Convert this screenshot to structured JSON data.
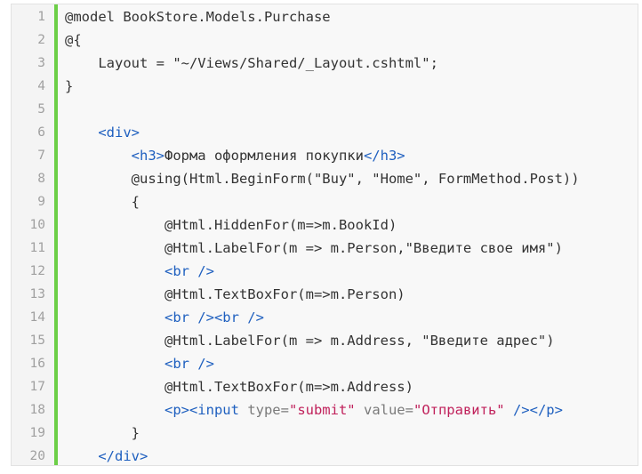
{
  "colors": {
    "background": "#f8f8f8",
    "gutter_bar": "#6ccf47",
    "line_number": "#a0a0a0",
    "plain": "#333333",
    "tag": "#1e5fbf",
    "attr": "#7a7a7a",
    "string": "#c0215b"
  },
  "lines": [
    {
      "n": "1",
      "tokens": [
        {
          "t": "@model BookStore.Models.Purchase",
          "c": "plain"
        }
      ]
    },
    {
      "n": "2",
      "tokens": [
        {
          "t": "@{",
          "c": "plain"
        }
      ]
    },
    {
      "n": "3",
      "tokens": [
        {
          "t": "    Layout = \"~/Views/Shared/_Layout.cshtml\";",
          "c": "plain"
        }
      ]
    },
    {
      "n": "4",
      "tokens": [
        {
          "t": "}",
          "c": "plain"
        }
      ]
    },
    {
      "n": "5",
      "tokens": []
    },
    {
      "n": "6",
      "tokens": [
        {
          "t": "    ",
          "c": "plain"
        },
        {
          "t": "<div>",
          "c": "tag"
        }
      ]
    },
    {
      "n": "7",
      "tokens": [
        {
          "t": "        ",
          "c": "plain"
        },
        {
          "t": "<h3>",
          "c": "tag"
        },
        {
          "t": "Форма оформления покупки",
          "c": "plain"
        },
        {
          "t": "</h3>",
          "c": "tag"
        }
      ]
    },
    {
      "n": "8",
      "tokens": [
        {
          "t": "        @using(Html.BeginForm(\"Buy\", \"Home\", FormMethod.Post))",
          "c": "plain"
        }
      ]
    },
    {
      "n": "9",
      "tokens": [
        {
          "t": "        {",
          "c": "plain"
        }
      ]
    },
    {
      "n": "10",
      "tokens": [
        {
          "t": "            @Html.HiddenFor(m=>m.BookId)",
          "c": "plain"
        }
      ]
    },
    {
      "n": "11",
      "tokens": [
        {
          "t": "            @Html.LabelFor(m => m.Person,\"Введите свое имя\")",
          "c": "plain"
        }
      ]
    },
    {
      "n": "12",
      "tokens": [
        {
          "t": "            ",
          "c": "plain"
        },
        {
          "t": "<br />",
          "c": "tag"
        }
      ]
    },
    {
      "n": "13",
      "tokens": [
        {
          "t": "            @Html.TextBoxFor(m=>m.Person)",
          "c": "plain"
        }
      ]
    },
    {
      "n": "14",
      "tokens": [
        {
          "t": "            ",
          "c": "plain"
        },
        {
          "t": "<br /><br />",
          "c": "tag"
        }
      ]
    },
    {
      "n": "15",
      "tokens": [
        {
          "t": "            @Html.LabelFor(m => m.Address, \"Введите адрес\")",
          "c": "plain"
        }
      ]
    },
    {
      "n": "16",
      "tokens": [
        {
          "t": "            ",
          "c": "plain"
        },
        {
          "t": "<br />",
          "c": "tag"
        }
      ]
    },
    {
      "n": "17",
      "tokens": [
        {
          "t": "            @Html.TextBoxFor(m=>m.Address)",
          "c": "plain"
        }
      ]
    },
    {
      "n": "18",
      "tokens": [
        {
          "t": "            ",
          "c": "plain"
        },
        {
          "t": "<p><input ",
          "c": "tag"
        },
        {
          "t": "type=",
          "c": "attr"
        },
        {
          "t": "\"submit\"",
          "c": "str"
        },
        {
          "t": " ",
          "c": "plain"
        },
        {
          "t": "value=",
          "c": "attr"
        },
        {
          "t": "\"Отправить\"",
          "c": "str"
        },
        {
          "t": " /></p>",
          "c": "tag"
        }
      ]
    },
    {
      "n": "19",
      "tokens": [
        {
          "t": "        }",
          "c": "plain"
        }
      ]
    },
    {
      "n": "20",
      "tokens": [
        {
          "t": "    ",
          "c": "plain"
        },
        {
          "t": "</div>",
          "c": "tag"
        }
      ]
    }
  ]
}
